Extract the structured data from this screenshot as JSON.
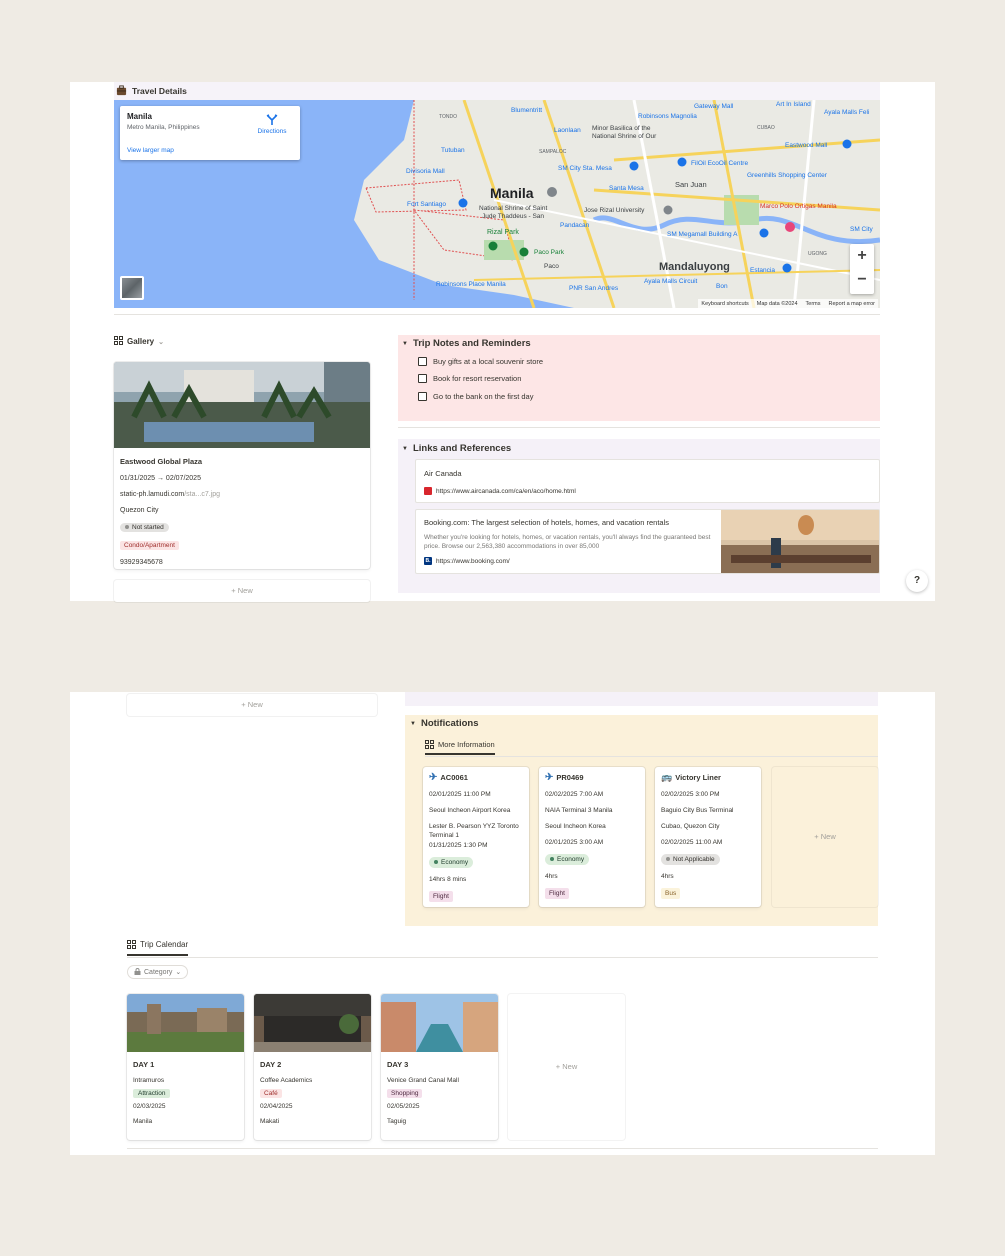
{
  "travel_details": {
    "title": "Travel Details",
    "map": {
      "place_name": "Manila",
      "place_region": "Metro Manila, Philippines",
      "view_larger": "View larger map",
      "directions": "Directions",
      "city_label": "Manila",
      "labels": [
        "Blumentritt",
        "TONDO",
        "Gateway Mall",
        "Art In Island",
        "Robinsons Magnolia",
        "Ayala Malls Feli",
        "Laonlaan",
        "Minor Basilica of the",
        "National Shrine of Our",
        "CUBAO",
        "Tutuban",
        "SAMPALOC",
        "Eastwood Mall",
        "Divisoria Mall",
        "SM City Sta. Mesa",
        "FilOil EcoOil Centre",
        "Greenhills Shopping Center",
        "Santa Mesa",
        "San Juan",
        "Fort Santiago",
        "National Shrine of Saint",
        "Jude Thaddeus - San",
        "Jose Rizal University",
        "Marco Polo Ortigas Manila",
        "Pandacan",
        "SM Megamall Building A",
        "Rizal Park",
        "Paco Park",
        "Paco",
        "UGONG",
        "Mandaluyong",
        "Estancia",
        "Robinsons Place Manila",
        "PNR San Andres",
        "Ayala Malls Circuit",
        "Bon",
        "SM City"
      ],
      "footer": [
        "Keyboard shortcuts",
        "Map data ©2024",
        "Terms",
        "Report a map error"
      ]
    }
  },
  "gallery": {
    "label": "Gallery",
    "card": {
      "title": "Eastwood Global Plaza",
      "dates": "01/31/2025 → 02/07/2025",
      "url_main": "static-ph.lamudi.com",
      "url_rest": "/sta...c7.jpg",
      "city": "Quezon City",
      "status": "Not started",
      "type": "Condo/Apartment",
      "phone": "93929345678"
    },
    "new_label": "+ New"
  },
  "trip_notes": {
    "title": "Trip Notes and Reminders",
    "items": [
      "Buy gifts at a local souvenir store",
      "Book for resort reservation",
      "Go to the bank on the first day"
    ]
  },
  "links": {
    "title": "Links and References",
    "bookmarks": [
      {
        "title": "Air Canada",
        "url": "https://www.aircanada.com/ca/en/aco/home.html"
      },
      {
        "title": "Booking.com: The largest selection of hotels, homes, and vacation rentals",
        "description": "Whether you're looking for hotels, homes, or vacation rentals, you'll always find the guaranteed best price. Browse our 2,563,380 accommodations in over 85,000",
        "url": "https://www.booking.com/",
        "favicon_letter": "B."
      }
    ]
  },
  "notifications": {
    "title": "Notifications",
    "tab": "More Information",
    "cards": [
      {
        "code": "AC0061",
        "rows": [
          "02/01/2025 11:00 PM",
          "Seoul Incheon Airport Korea",
          "Lester B. Pearson YYZ Toronto Terminal 1",
          "01/31/2025 1:30 PM"
        ],
        "class": "Economy",
        "duration": "14hrs 8 mins",
        "mode": "Flight"
      },
      {
        "code": "PR0469",
        "rows": [
          "02/02/2025 7:00 AM",
          "NAIA Terminal 3 Manila",
          "Seoul Incheon Korea",
          "02/01/2025 3:00 AM"
        ],
        "class": "Economy",
        "duration": "4hrs",
        "mode": "Flight"
      },
      {
        "code": "Victory Liner",
        "rows": [
          "02/02/2025 3:00 PM",
          "Baguio City Bus Terminal",
          "Cubao, Quezon City",
          "02/02/2025 11:00 AM"
        ],
        "class": "Not Applicable",
        "duration": "4hrs",
        "mode": "Bus"
      }
    ],
    "new_label": "+ New"
  },
  "trip_calendar": {
    "tab": "Trip Calendar",
    "filter": "Category",
    "days": [
      {
        "day": "DAY 1",
        "place": "Intramuros",
        "category": "Attraction",
        "date": "02/03/2025",
        "city": "Manila"
      },
      {
        "day": "DAY 2",
        "place": "Coffee Academics",
        "category": "Café",
        "date": "02/04/2025",
        "city": "Makati"
      },
      {
        "day": "DAY 3",
        "place": "Venice Grand Canal Mall",
        "category": "Shopping",
        "date": "02/05/2025",
        "city": "Taguig"
      }
    ],
    "new_label": "+ New"
  },
  "top_new_label": "+ New",
  "help_label": "?"
}
